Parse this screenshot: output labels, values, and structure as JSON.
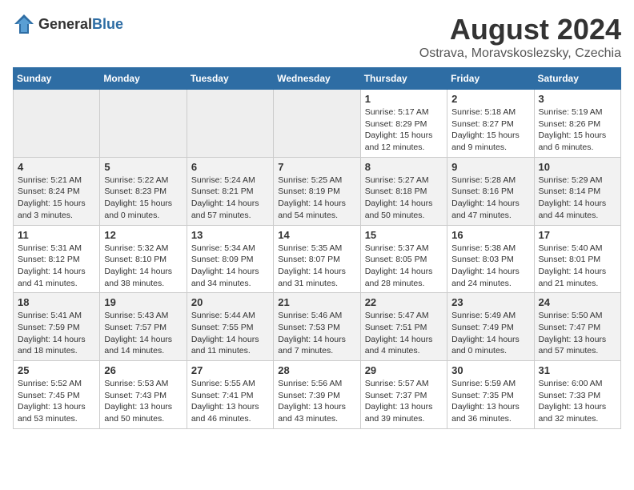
{
  "logo": {
    "general": "General",
    "blue": "Blue"
  },
  "header": {
    "month": "August 2024",
    "location": "Ostrava, Moravskoslezsky, Czechia"
  },
  "weekdays": [
    "Sunday",
    "Monday",
    "Tuesday",
    "Wednesday",
    "Thursday",
    "Friday",
    "Saturday"
  ],
  "weeks": [
    [
      {
        "day": "",
        "info": ""
      },
      {
        "day": "",
        "info": ""
      },
      {
        "day": "",
        "info": ""
      },
      {
        "day": "",
        "info": ""
      },
      {
        "day": "1",
        "info": "Sunrise: 5:17 AM\nSunset: 8:29 PM\nDaylight: 15 hours\nand 12 minutes."
      },
      {
        "day": "2",
        "info": "Sunrise: 5:18 AM\nSunset: 8:27 PM\nDaylight: 15 hours\nand 9 minutes."
      },
      {
        "day": "3",
        "info": "Sunrise: 5:19 AM\nSunset: 8:26 PM\nDaylight: 15 hours\nand 6 minutes."
      }
    ],
    [
      {
        "day": "4",
        "info": "Sunrise: 5:21 AM\nSunset: 8:24 PM\nDaylight: 15 hours\nand 3 minutes."
      },
      {
        "day": "5",
        "info": "Sunrise: 5:22 AM\nSunset: 8:23 PM\nDaylight: 15 hours\nand 0 minutes."
      },
      {
        "day": "6",
        "info": "Sunrise: 5:24 AM\nSunset: 8:21 PM\nDaylight: 14 hours\nand 57 minutes."
      },
      {
        "day": "7",
        "info": "Sunrise: 5:25 AM\nSunset: 8:19 PM\nDaylight: 14 hours\nand 54 minutes."
      },
      {
        "day": "8",
        "info": "Sunrise: 5:27 AM\nSunset: 8:18 PM\nDaylight: 14 hours\nand 50 minutes."
      },
      {
        "day": "9",
        "info": "Sunrise: 5:28 AM\nSunset: 8:16 PM\nDaylight: 14 hours\nand 47 minutes."
      },
      {
        "day": "10",
        "info": "Sunrise: 5:29 AM\nSunset: 8:14 PM\nDaylight: 14 hours\nand 44 minutes."
      }
    ],
    [
      {
        "day": "11",
        "info": "Sunrise: 5:31 AM\nSunset: 8:12 PM\nDaylight: 14 hours\nand 41 minutes."
      },
      {
        "day": "12",
        "info": "Sunrise: 5:32 AM\nSunset: 8:10 PM\nDaylight: 14 hours\nand 38 minutes."
      },
      {
        "day": "13",
        "info": "Sunrise: 5:34 AM\nSunset: 8:09 PM\nDaylight: 14 hours\nand 34 minutes."
      },
      {
        "day": "14",
        "info": "Sunrise: 5:35 AM\nSunset: 8:07 PM\nDaylight: 14 hours\nand 31 minutes."
      },
      {
        "day": "15",
        "info": "Sunrise: 5:37 AM\nSunset: 8:05 PM\nDaylight: 14 hours\nand 28 minutes."
      },
      {
        "day": "16",
        "info": "Sunrise: 5:38 AM\nSunset: 8:03 PM\nDaylight: 14 hours\nand 24 minutes."
      },
      {
        "day": "17",
        "info": "Sunrise: 5:40 AM\nSunset: 8:01 PM\nDaylight: 14 hours\nand 21 minutes."
      }
    ],
    [
      {
        "day": "18",
        "info": "Sunrise: 5:41 AM\nSunset: 7:59 PM\nDaylight: 14 hours\nand 18 minutes."
      },
      {
        "day": "19",
        "info": "Sunrise: 5:43 AM\nSunset: 7:57 PM\nDaylight: 14 hours\nand 14 minutes."
      },
      {
        "day": "20",
        "info": "Sunrise: 5:44 AM\nSunset: 7:55 PM\nDaylight: 14 hours\nand 11 minutes."
      },
      {
        "day": "21",
        "info": "Sunrise: 5:46 AM\nSunset: 7:53 PM\nDaylight: 14 hours\nand 7 minutes."
      },
      {
        "day": "22",
        "info": "Sunrise: 5:47 AM\nSunset: 7:51 PM\nDaylight: 14 hours\nand 4 minutes."
      },
      {
        "day": "23",
        "info": "Sunrise: 5:49 AM\nSunset: 7:49 PM\nDaylight: 14 hours\nand 0 minutes."
      },
      {
        "day": "24",
        "info": "Sunrise: 5:50 AM\nSunset: 7:47 PM\nDaylight: 13 hours\nand 57 minutes."
      }
    ],
    [
      {
        "day": "25",
        "info": "Sunrise: 5:52 AM\nSunset: 7:45 PM\nDaylight: 13 hours\nand 53 minutes."
      },
      {
        "day": "26",
        "info": "Sunrise: 5:53 AM\nSunset: 7:43 PM\nDaylight: 13 hours\nand 50 minutes."
      },
      {
        "day": "27",
        "info": "Sunrise: 5:55 AM\nSunset: 7:41 PM\nDaylight: 13 hours\nand 46 minutes."
      },
      {
        "day": "28",
        "info": "Sunrise: 5:56 AM\nSunset: 7:39 PM\nDaylight: 13 hours\nand 43 minutes."
      },
      {
        "day": "29",
        "info": "Sunrise: 5:57 AM\nSunset: 7:37 PM\nDaylight: 13 hours\nand 39 minutes."
      },
      {
        "day": "30",
        "info": "Sunrise: 5:59 AM\nSunset: 7:35 PM\nDaylight: 13 hours\nand 36 minutes."
      },
      {
        "day": "31",
        "info": "Sunrise: 6:00 AM\nSunset: 7:33 PM\nDaylight: 13 hours\nand 32 minutes."
      }
    ]
  ]
}
